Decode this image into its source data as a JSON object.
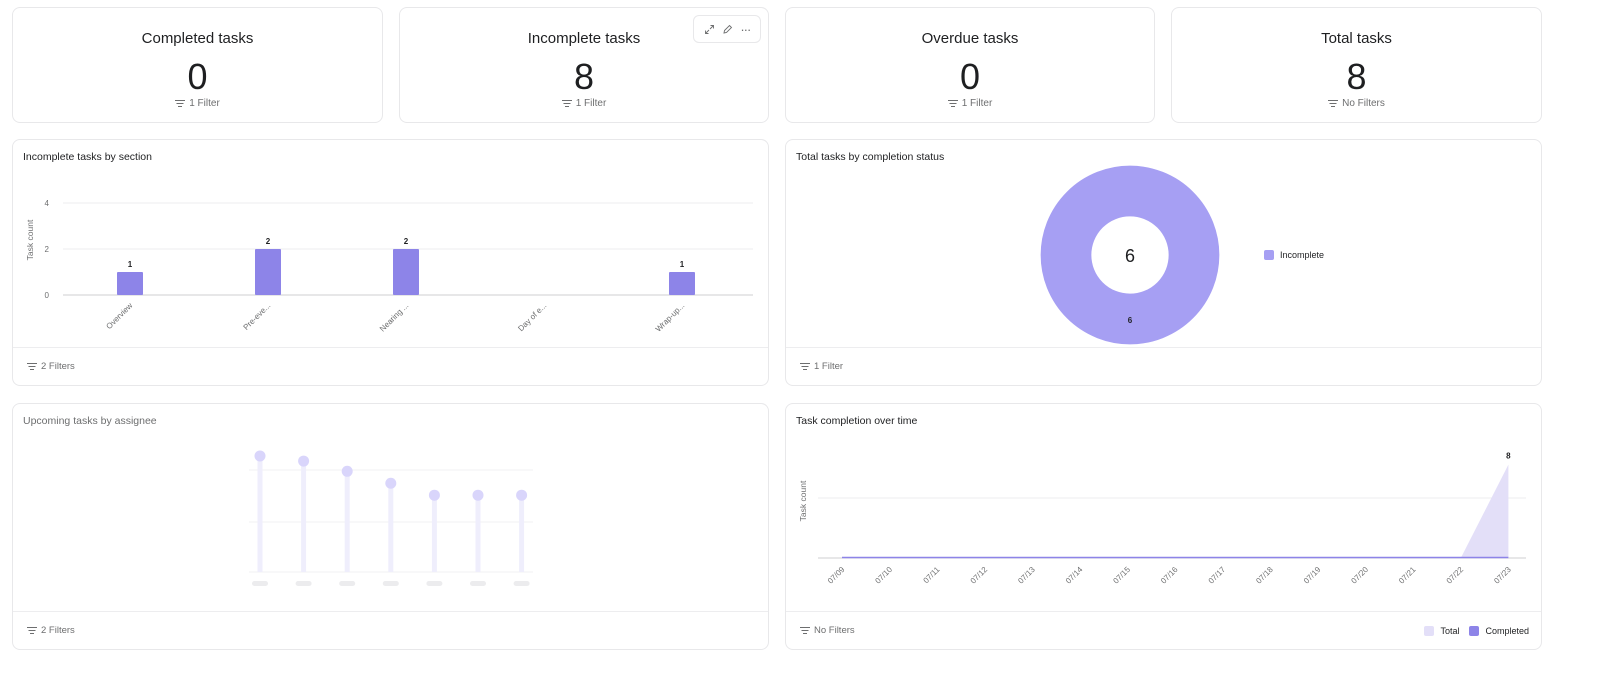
{
  "stats": [
    {
      "title": "Completed tasks",
      "value": "0",
      "filter": "1 Filter"
    },
    {
      "title": "Incomplete tasks",
      "value": "8",
      "filter": "1 Filter"
    },
    {
      "title": "Overdue tasks",
      "value": "0",
      "filter": "1 Filter"
    },
    {
      "title": "Total tasks",
      "value": "8",
      "filter": "No Filters"
    }
  ],
  "hover_tools": {
    "expand_icon": "expand-icon",
    "edit_icon": "pencil-icon",
    "more_icon": "more-icon",
    "more_glyph": "···"
  },
  "colors": {
    "bar": "#8d84e8",
    "donut": "#a69ff3",
    "lollipop_stem": "#efeefc",
    "lollipop_dot": "#d9d5fb",
    "area_total": "#e3dff8",
    "completed": "#8d84e8",
    "grid": "#ededef"
  },
  "panels": {
    "bar": {
      "title": "Incomplete tasks by section",
      "filter": "2 Filters"
    },
    "donut": {
      "title": "Total tasks by completion status",
      "filter": "1 Filter",
      "center_label": "6",
      "slice_label": "6",
      "legend": "Incomplete"
    },
    "lollipop": {
      "title": "Upcoming tasks by assignee",
      "filter": "2 Filters"
    },
    "area": {
      "title": "Task completion over time",
      "filter": "No Filters",
      "legend_total": "Total",
      "legend_completed": "Completed"
    }
  },
  "chart_data": [
    {
      "type": "bar",
      "title": "Incomplete tasks by section",
      "categories": [
        "Overview",
        "Pre-eve...",
        "Nearing ...",
        "Day of e...",
        "Wrap-up..."
      ],
      "values": [
        1,
        2,
        2,
        0,
        1
      ],
      "data_labels": [
        "1",
        "2",
        "2",
        "",
        "1"
      ],
      "xlabel": "",
      "ylabel": "Task count",
      "yticks": [
        "0",
        "2",
        "4"
      ],
      "ylim": [
        0,
        4
      ],
      "grid": true
    },
    {
      "type": "pie",
      "title": "Total tasks by completion status",
      "labels": [
        "Incomplete"
      ],
      "values": [
        6
      ],
      "center_total": 6,
      "legend": "right"
    },
    {
      "type": "bar",
      "title": "Upcoming tasks by assignee",
      "placeholder": true,
      "categories": [
        "",
        "",
        "",
        "",
        "",
        "",
        ""
      ],
      "values": [
        6.8,
        6.5,
        5.9,
        5.2,
        4.5,
        4.5,
        4.5
      ],
      "ylim": [
        0,
        7.5
      ]
    },
    {
      "type": "area",
      "title": "Task completion over time",
      "x": [
        "07/09",
        "07/10",
        "07/11",
        "07/12",
        "07/13",
        "07/14",
        "07/15",
        "07/16",
        "07/17",
        "07/18",
        "07/19",
        "07/20",
        "07/21",
        "07/22",
        "07/23"
      ],
      "series": [
        {
          "name": "Total",
          "values": [
            0,
            0,
            0,
            0,
            0,
            0,
            0,
            0,
            0,
            0,
            0,
            0,
            0,
            0,
            8
          ]
        },
        {
          "name": "Completed",
          "values": [
            0,
            0,
            0,
            0,
            0,
            0,
            0,
            0,
            0,
            0,
            0,
            0,
            0,
            0,
            0
          ]
        }
      ],
      "data_labels": [
        {
          "index": 14,
          "series": "Total",
          "text": "8"
        }
      ],
      "ylabel": "Task count",
      "ylim": [
        0,
        12
      ],
      "legend": "bottom-right",
      "grid": true
    }
  ]
}
